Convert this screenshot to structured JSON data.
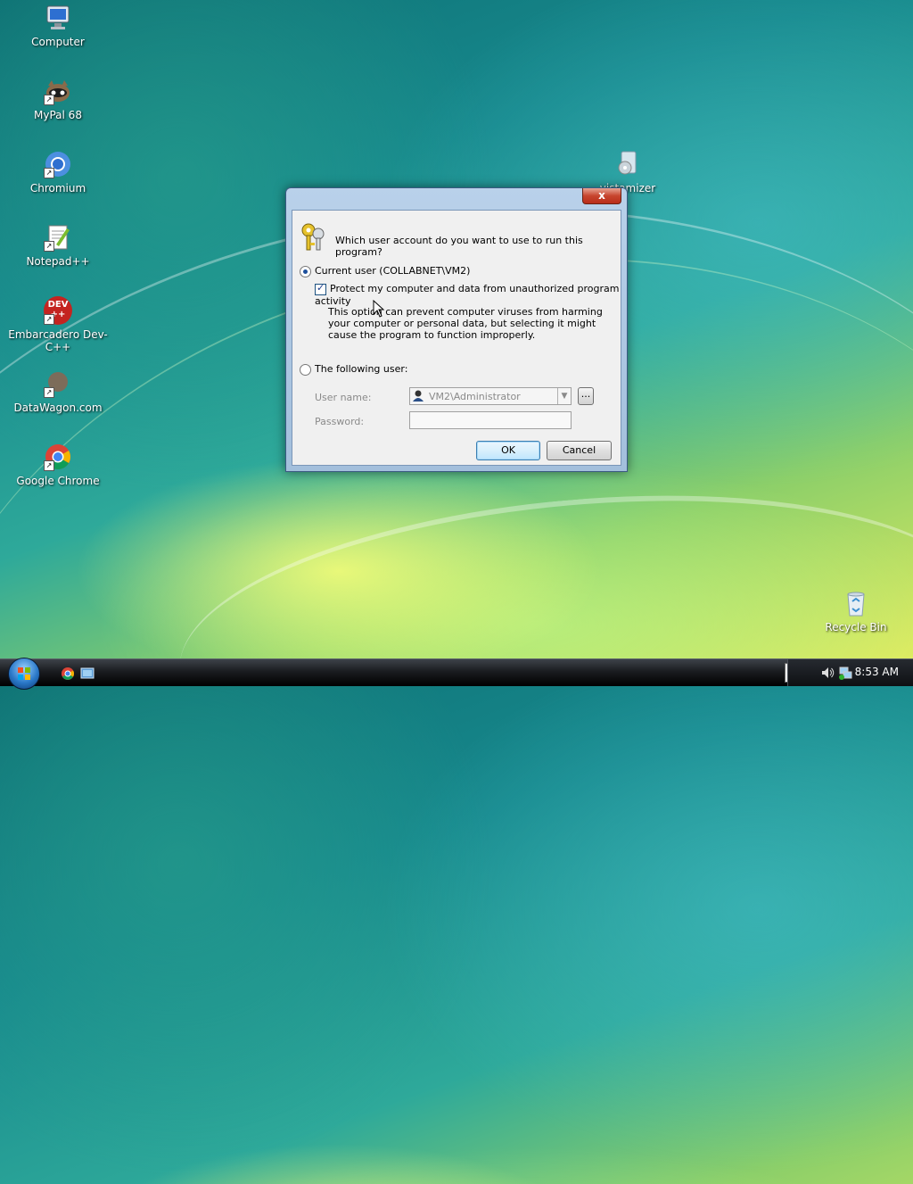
{
  "desktop": {
    "icons": [
      {
        "label": "Computer",
        "icon": "computer-icon"
      },
      {
        "label": "MyPal 68",
        "icon": "mypal-icon"
      },
      {
        "label": "Chromium",
        "icon": "chromium-icon"
      },
      {
        "label": "Notepad++",
        "icon": "notepad-plus-plus-icon"
      },
      {
        "label": "Embarcadero Dev-C++",
        "icon": "devcpp-icon"
      },
      {
        "label": "DataWagon.com",
        "icon": "datawagon-icon"
      },
      {
        "label": "Google Chrome",
        "icon": "chrome-icon"
      },
      {
        "label": "vistamizer",
        "icon": "vistamizer-icon"
      },
      {
        "label": "Recycle Bin",
        "icon": "recycle-bin-icon"
      }
    ],
    "devcpp_icon_text": "DEV",
    "devcpp_icon_text2": "++"
  },
  "dialog": {
    "close_label": "x",
    "question": "Which user account do you want to use to run this program?",
    "current_user_label": "Current user (COLLABNET\\VM2)",
    "protect_label": "Protect my computer and data from unauthorized program activity",
    "protect_desc": "This option can prevent computer viruses from harming your computer or personal data, but selecting it might cause the program to function improperly.",
    "following_user_label": "The following user:",
    "username_label": "User name:",
    "username_value": "VM2\\Administrator",
    "password_label": "Password:",
    "browse_label": "...",
    "ok_label": "OK",
    "cancel_label": "Cancel"
  },
  "taskbar": {
    "time": "8:53 AM"
  }
}
